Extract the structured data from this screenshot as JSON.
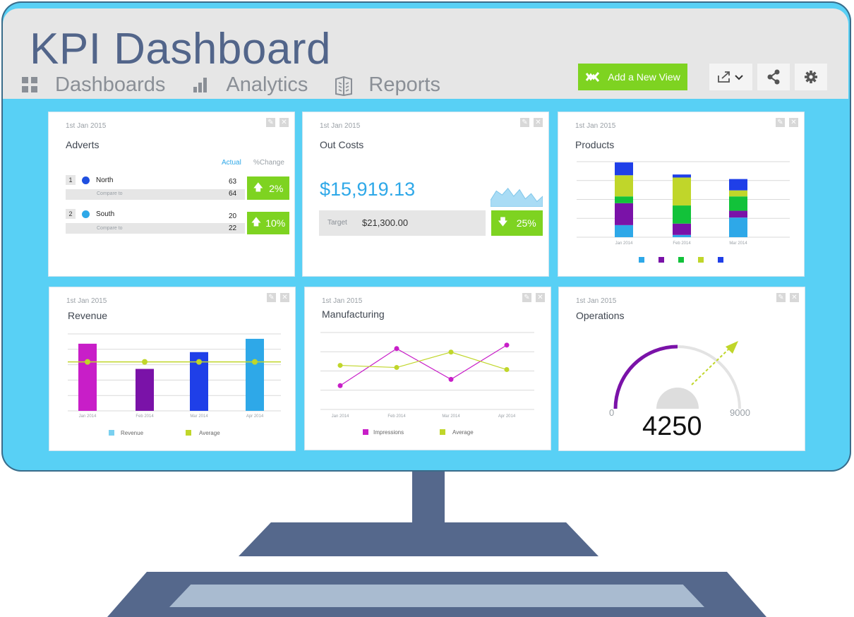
{
  "app": {
    "title": "KPI Dashboard"
  },
  "nav": [
    {
      "label": "Dashboards",
      "icon": "grid-icon"
    },
    {
      "label": "Analytics",
      "icon": "bar-chart-icon"
    },
    {
      "label": "Reports",
      "icon": "book-icon"
    }
  ],
  "toolbar": {
    "add_view_label": "Add a New View",
    "export_icon": "export-icon",
    "share_icon": "share-icon",
    "settings_icon": "gear-icon"
  },
  "colors": {
    "accent_green": "#7ed321",
    "brand_blue": "#52658a",
    "screen_blue": "#58d0f5"
  },
  "widgets": {
    "adverts": {
      "date": "1st Jan 2015",
      "title": "Adverts",
      "col_actual": "Actual",
      "col_change": "%Change",
      "rows": [
        {
          "rank": "1",
          "name": "North",
          "actual": "63",
          "compare_label": "Compare to",
          "compare": "64",
          "change": "2%",
          "color": "#1f4fe0"
        },
        {
          "rank": "2",
          "name": "South",
          "actual": "20",
          "compare_label": "Compare to",
          "compare": "22",
          "change": "10%",
          "color": "#2ea8e8"
        }
      ]
    },
    "outcosts": {
      "date": "1st Jan 2015",
      "title": "Out Costs",
      "amount": "$15,919.13",
      "target_label": "Target",
      "target_value": "$21,300.00",
      "change": "25%"
    },
    "products": {
      "date": "1st Jan 2015",
      "title": "Products"
    },
    "revenue": {
      "date": "1st Jan 2015",
      "title": "Revenue"
    },
    "manufacturing": {
      "date": "1st Jan 2015",
      "title": "Manufacturing"
    },
    "operations": {
      "date": "1st Jan 2015",
      "title": "Operations",
      "min": "0",
      "max": "9000",
      "value": "4250"
    }
  },
  "chart_data": [
    {
      "id": "products",
      "type": "bar",
      "stacked": true,
      "categories": [
        "Jan 2014",
        "Feb 2014",
        "Mar 2014"
      ],
      "series": [
        {
          "values": [
            16,
            3,
            26
          ],
          "color": "#2ea8e8"
        },
        {
          "values": [
            29,
            15,
            9
          ],
          "color": "#7a12a8"
        },
        {
          "values": [
            9,
            24,
            19
          ],
          "color": "#12c23a"
        },
        {
          "values": [
            28,
            37,
            8
          ],
          "color": "#c0d62a"
        },
        {
          "values": [
            17,
            4,
            15
          ],
          "color": "#1f3fe8"
        }
      ],
      "ylim": [
        0,
        100
      ],
      "grid": true,
      "legend": "bottom"
    },
    {
      "id": "revenue",
      "type": "bar",
      "categories": [
        "Jan 2014",
        "Feb 2014",
        "Mar 2014",
        "Apr 2014"
      ],
      "series": [
        {
          "name": "Revenue",
          "values": [
            96,
            60,
            84,
            103
          ],
          "colors": [
            "#c81ec8",
            "#7a12a8",
            "#1f3fe8",
            "#2ea8e8"
          ],
          "legend_color": "#7ad0f0"
        },
        {
          "name": "Average",
          "type": "line",
          "values": [
            70,
            70,
            70,
            70
          ],
          "color": "#c0d62a"
        }
      ],
      "ylim": [
        0,
        110
      ],
      "grid": true,
      "legend": "bottom"
    },
    {
      "id": "manufacturing",
      "type": "line",
      "categories": [
        "Jan 2014",
        "Feb 2014",
        "Mar 2014",
        "Apr 2014"
      ],
      "series": [
        {
          "name": "Impressions",
          "values": [
            34,
            87,
            43,
            92
          ],
          "color": "#c81ec8"
        },
        {
          "name": "Average",
          "values": [
            63,
            60,
            82,
            57
          ],
          "color": "#c0d62a"
        }
      ],
      "ylim": [
        0,
        110
      ],
      "grid": true,
      "legend": "bottom"
    },
    {
      "id": "outcosts-spark",
      "type": "area",
      "values": [
        5,
        12,
        9,
        14,
        8,
        13,
        6,
        10,
        4,
        8
      ],
      "color": "#a9dcf5"
    }
  ]
}
